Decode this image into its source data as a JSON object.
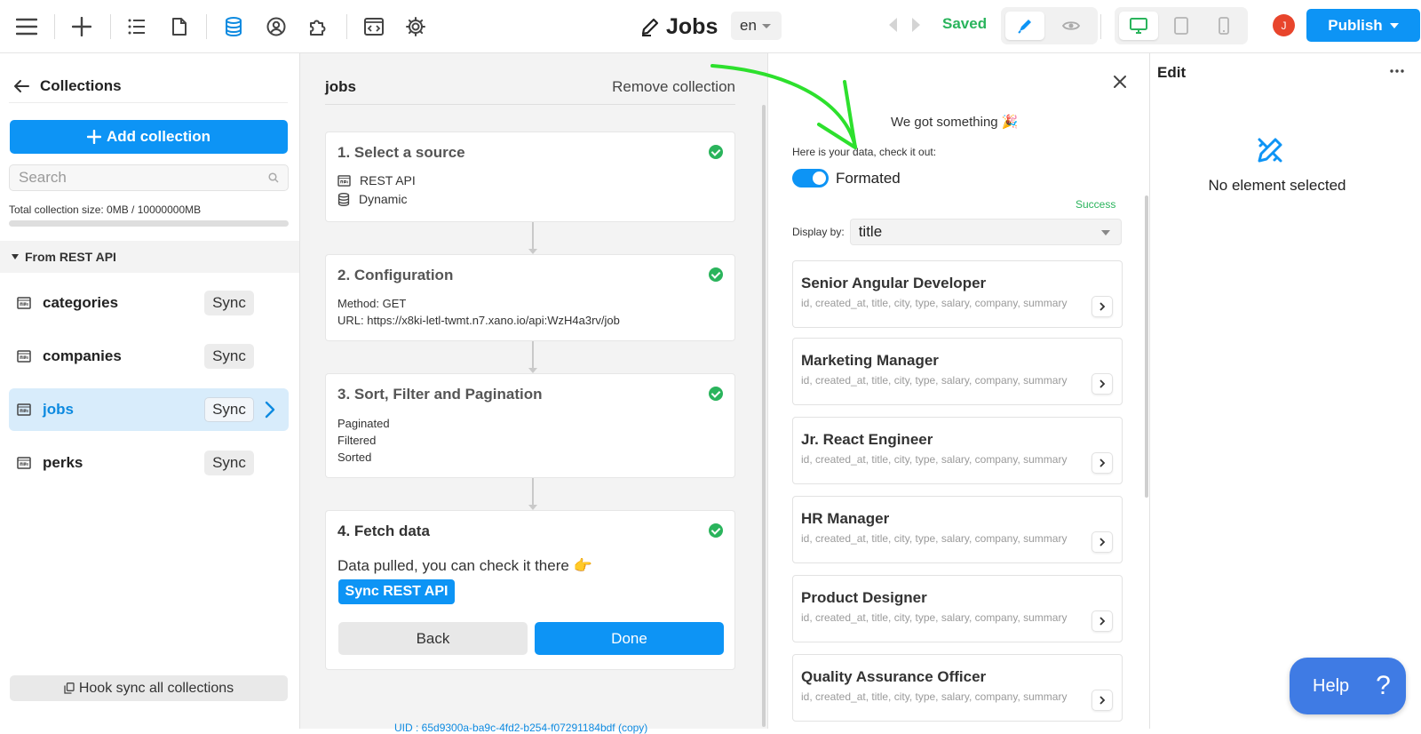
{
  "topbar": {
    "title": "Jobs",
    "language": "en",
    "save_status": "Saved",
    "avatar_initial": "J",
    "publish_label": "Publish",
    "accent_color": "#0d94f5"
  },
  "left": {
    "title": "Collections",
    "add_label": "Add collection",
    "search_placeholder": "Search",
    "size_text": "Total collection size: 0MB / 10000000MB",
    "size_fraction": 0.0,
    "group_label": "From REST API",
    "items": [
      {
        "name": "categories",
        "sync": "Sync"
      },
      {
        "name": "companies",
        "sync": "Sync"
      },
      {
        "name": "jobs",
        "sync": "Sync",
        "active": true
      },
      {
        "name": "perks",
        "sync": "Sync"
      }
    ],
    "hook_sync_label": "Hook sync all collections"
  },
  "middle": {
    "collection_name": "jobs",
    "remove_label": "Remove collection",
    "step1": {
      "title": "1. Select a source",
      "source": "REST API",
      "mode": "Dynamic"
    },
    "step2": {
      "title": "2. Configuration",
      "method": "Method: GET",
      "url": "URL: https://x8ki-letl-twmt.n7.xano.io/api:WzH4a3rv/job"
    },
    "step3": {
      "title": "3. Sort, Filter and Pagination",
      "lines": [
        "Paginated",
        "Filtered",
        "Sorted"
      ]
    },
    "step4": {
      "title": "4. Fetch data",
      "text": "Data pulled, you can check it there 👉",
      "sync_button": "Sync REST API",
      "back": "Back",
      "done": "Done"
    },
    "uid_text": "UID : 65d9300a-ba9c-4fd2-b254-f07291184bdf (copy)"
  },
  "data_panel": {
    "headline": "We got something 🎉",
    "subtitle": "Here is your data, check it out:",
    "toggle_label": "Formated",
    "toggle_on": true,
    "status": "Success",
    "display_by_label": "Display by:",
    "display_by_value": "title",
    "records": [
      {
        "title": "Senior Angular Developer",
        "fields": "id, created_at, title, city, type, salary, company, summary"
      },
      {
        "title": "Marketing Manager",
        "fields": "id, created_at, title, city, type, salary, company, summary"
      },
      {
        "title": "Jr. React Engineer",
        "fields": "id, created_at, title, city, type, salary, company, summary"
      },
      {
        "title": "HR Manager",
        "fields": "id, created_at, title, city, type, salary, company, summary"
      },
      {
        "title": "Product Designer",
        "fields": "id, created_at, title, city, type, salary, company, summary"
      },
      {
        "title": "Quality Assurance Officer",
        "fields": "id, created_at, title, city, type, salary, company, summary"
      }
    ]
  },
  "edit_panel": {
    "title": "Edit",
    "empty_text": "No element selected"
  },
  "help": {
    "label": "Help",
    "symbol": "?"
  }
}
